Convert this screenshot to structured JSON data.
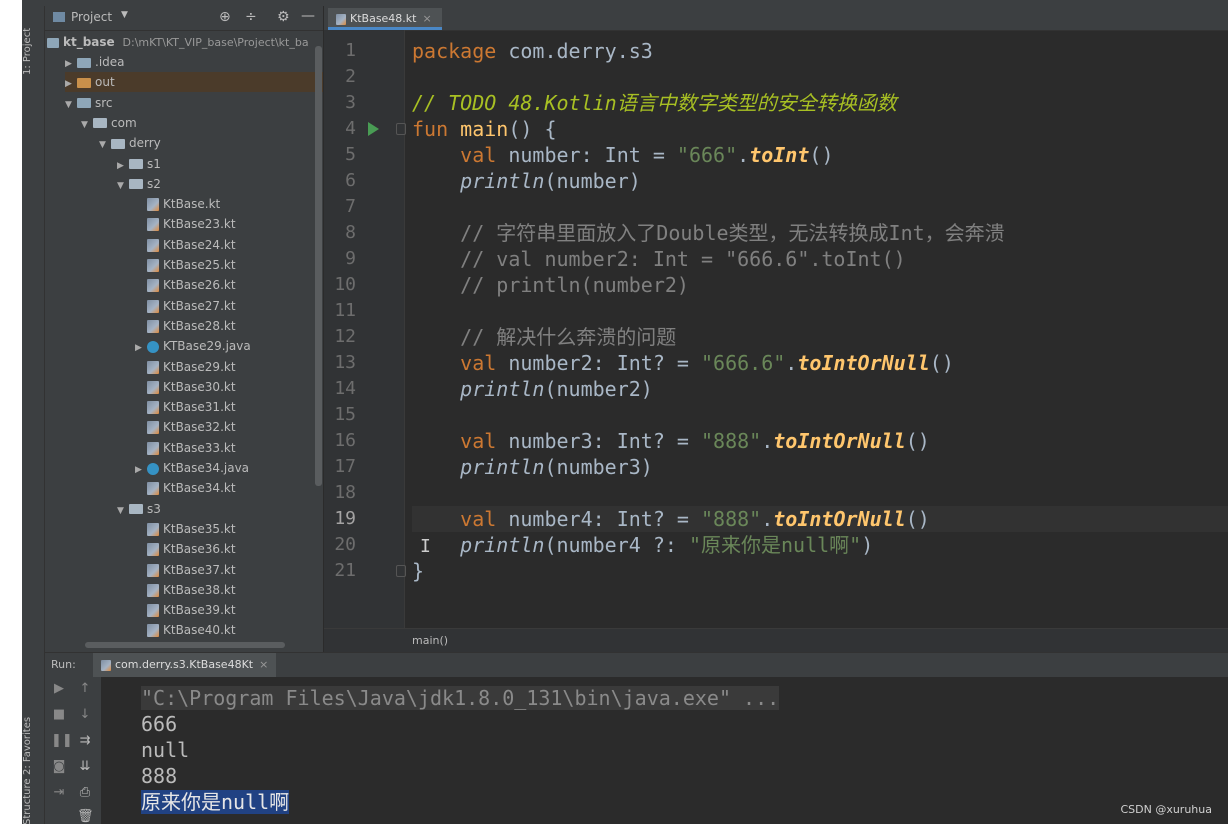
{
  "sidebar_tabs": {
    "project": "1: Project",
    "favorites": "2: Favorites",
    "structure": "Structure"
  },
  "project_panel": {
    "title": "Project",
    "root_label": "kt_base",
    "root_path": "D:\\mKT\\KT_VIP_base\\Project\\kt_ba",
    "tree": [
      {
        "label": ".idea",
        "kind": "folder",
        "depth": 1,
        "arrow": "▶"
      },
      {
        "label": "out",
        "kind": "folder-out",
        "depth": 1,
        "arrow": "▶"
      },
      {
        "label": "src",
        "kind": "folder",
        "depth": 1,
        "arrow": "▼"
      },
      {
        "label": "com",
        "kind": "pkg",
        "depth": 2,
        "arrow": "▼"
      },
      {
        "label": "derry",
        "kind": "pkg",
        "depth": 3,
        "arrow": "▼"
      },
      {
        "label": "s1",
        "kind": "pkg",
        "depth": 4,
        "arrow": "▶"
      },
      {
        "label": "s2",
        "kind": "pkg",
        "depth": 4,
        "arrow": "▼"
      },
      {
        "label": "KtBase.kt",
        "kind": "kt",
        "depth": 5,
        "arrow": ""
      },
      {
        "label": "KtBase23.kt",
        "kind": "kt",
        "depth": 5,
        "arrow": ""
      },
      {
        "label": "KtBase24.kt",
        "kind": "kt",
        "depth": 5,
        "arrow": ""
      },
      {
        "label": "KtBase25.kt",
        "kind": "kt",
        "depth": 5,
        "arrow": ""
      },
      {
        "label": "KtBase26.kt",
        "kind": "kt",
        "depth": 5,
        "arrow": ""
      },
      {
        "label": "KtBase27.kt",
        "kind": "kt",
        "depth": 5,
        "arrow": ""
      },
      {
        "label": "KtBase28.kt",
        "kind": "kt",
        "depth": 5,
        "arrow": ""
      },
      {
        "label": "KTBase29.java",
        "kind": "java",
        "depth": 5,
        "arrow": "▶"
      },
      {
        "label": "KtBase29.kt",
        "kind": "kt",
        "depth": 5,
        "arrow": ""
      },
      {
        "label": "KtBase30.kt",
        "kind": "kt",
        "depth": 5,
        "arrow": ""
      },
      {
        "label": "KtBase31.kt",
        "kind": "kt",
        "depth": 5,
        "arrow": ""
      },
      {
        "label": "KtBase32.kt",
        "kind": "kt",
        "depth": 5,
        "arrow": ""
      },
      {
        "label": "KtBase33.kt",
        "kind": "kt",
        "depth": 5,
        "arrow": ""
      },
      {
        "label": "KtBase34.java",
        "kind": "java",
        "depth": 5,
        "arrow": "▶"
      },
      {
        "label": "KtBase34.kt",
        "kind": "kt",
        "depth": 5,
        "arrow": ""
      },
      {
        "label": "s3",
        "kind": "pkg",
        "depth": 4,
        "arrow": "▼"
      },
      {
        "label": "KtBase35.kt",
        "kind": "kt",
        "depth": 5,
        "arrow": ""
      },
      {
        "label": "KtBase36.kt",
        "kind": "kt",
        "depth": 5,
        "arrow": ""
      },
      {
        "label": "KtBase37.kt",
        "kind": "kt",
        "depth": 5,
        "arrow": ""
      },
      {
        "label": "KtBase38.kt",
        "kind": "kt",
        "depth": 5,
        "arrow": ""
      },
      {
        "label": "KtBase39.kt",
        "kind": "kt",
        "depth": 5,
        "arrow": ""
      },
      {
        "label": "KtBase40.kt",
        "kind": "kt",
        "depth": 5,
        "arrow": ""
      }
    ]
  },
  "editor": {
    "tab_label": "KtBase48.kt",
    "current_line": 19,
    "breadcrumb": "main()",
    "lines": [
      [
        [
          "kw",
          "package"
        ],
        [
          "p",
          " com.derry.s3"
        ]
      ],
      [],
      [
        [
          "todo",
          "// TODO 48.Kotlin语言中数字类型的安全转换函数"
        ]
      ],
      [
        [
          "kw",
          "fun"
        ],
        [
          "p",
          " "
        ],
        [
          "fn",
          "main"
        ],
        [
          "p",
          "() {"
        ]
      ],
      [
        [
          "p",
          "    "
        ],
        [
          "kw",
          "val"
        ],
        [
          "p",
          " number: Int = "
        ],
        [
          "str",
          "\"666\""
        ],
        [
          "p",
          "."
        ],
        [
          "itfn",
          "toInt"
        ],
        [
          "p",
          "()"
        ]
      ],
      [
        [
          "p",
          "    "
        ],
        [
          "it",
          "println"
        ],
        [
          "p",
          "(number)"
        ]
      ],
      [],
      [
        [
          "cmt",
          "    // 字符串里面放入了Double类型，无法转换成Int，会奔溃"
        ]
      ],
      [
        [
          "cmt",
          "    // val number2: Int = \"666.6\".toInt()"
        ]
      ],
      [
        [
          "cmt",
          "    // println(number2)"
        ]
      ],
      [],
      [
        [
          "cmt",
          "    // 解决什么奔溃的问题"
        ]
      ],
      [
        [
          "p",
          "    "
        ],
        [
          "kw",
          "val"
        ],
        [
          "p",
          " number2: Int? = "
        ],
        [
          "str",
          "\"666.6\""
        ],
        [
          "p",
          "."
        ],
        [
          "itfn",
          "toIntOrNull"
        ],
        [
          "p",
          "()"
        ]
      ],
      [
        [
          "p",
          "    "
        ],
        [
          "it",
          "println"
        ],
        [
          "p",
          "(number2)"
        ]
      ],
      [],
      [
        [
          "p",
          "    "
        ],
        [
          "kw",
          "val"
        ],
        [
          "p",
          " number3: Int? = "
        ],
        [
          "str",
          "\"888\""
        ],
        [
          "p",
          "."
        ],
        [
          "itfn",
          "toIntOrNull"
        ],
        [
          "p",
          "()"
        ]
      ],
      [
        [
          "p",
          "    "
        ],
        [
          "it",
          "println"
        ],
        [
          "p",
          "(number3)"
        ]
      ],
      [],
      [
        [
          "p",
          "    "
        ],
        [
          "kw",
          "val"
        ],
        [
          "p",
          " number4: Int? = "
        ],
        [
          "str",
          "\"888\""
        ],
        [
          "p",
          "."
        ],
        [
          "itfn",
          "toIntOrNull"
        ],
        [
          "p",
          "()"
        ]
      ],
      [
        [
          "p",
          "    "
        ],
        [
          "it",
          "println"
        ],
        [
          "p",
          "(number4 ?: "
        ],
        [
          "str",
          "\"原来你是null啊\""
        ],
        [
          "p",
          ")"
        ]
      ],
      [
        [
          "p",
          "}"
        ]
      ]
    ]
  },
  "run_panel": {
    "label": "Run:",
    "tab_label": "com.derry.s3.KtBase48Kt",
    "output": [
      "\"C:\\Program Files\\Java\\jdk1.8.0_131\\bin\\java.exe\" ...",
      "666",
      "null",
      "888",
      "原来你是null啊"
    ]
  },
  "watermark": "CSDN @xuruhua"
}
